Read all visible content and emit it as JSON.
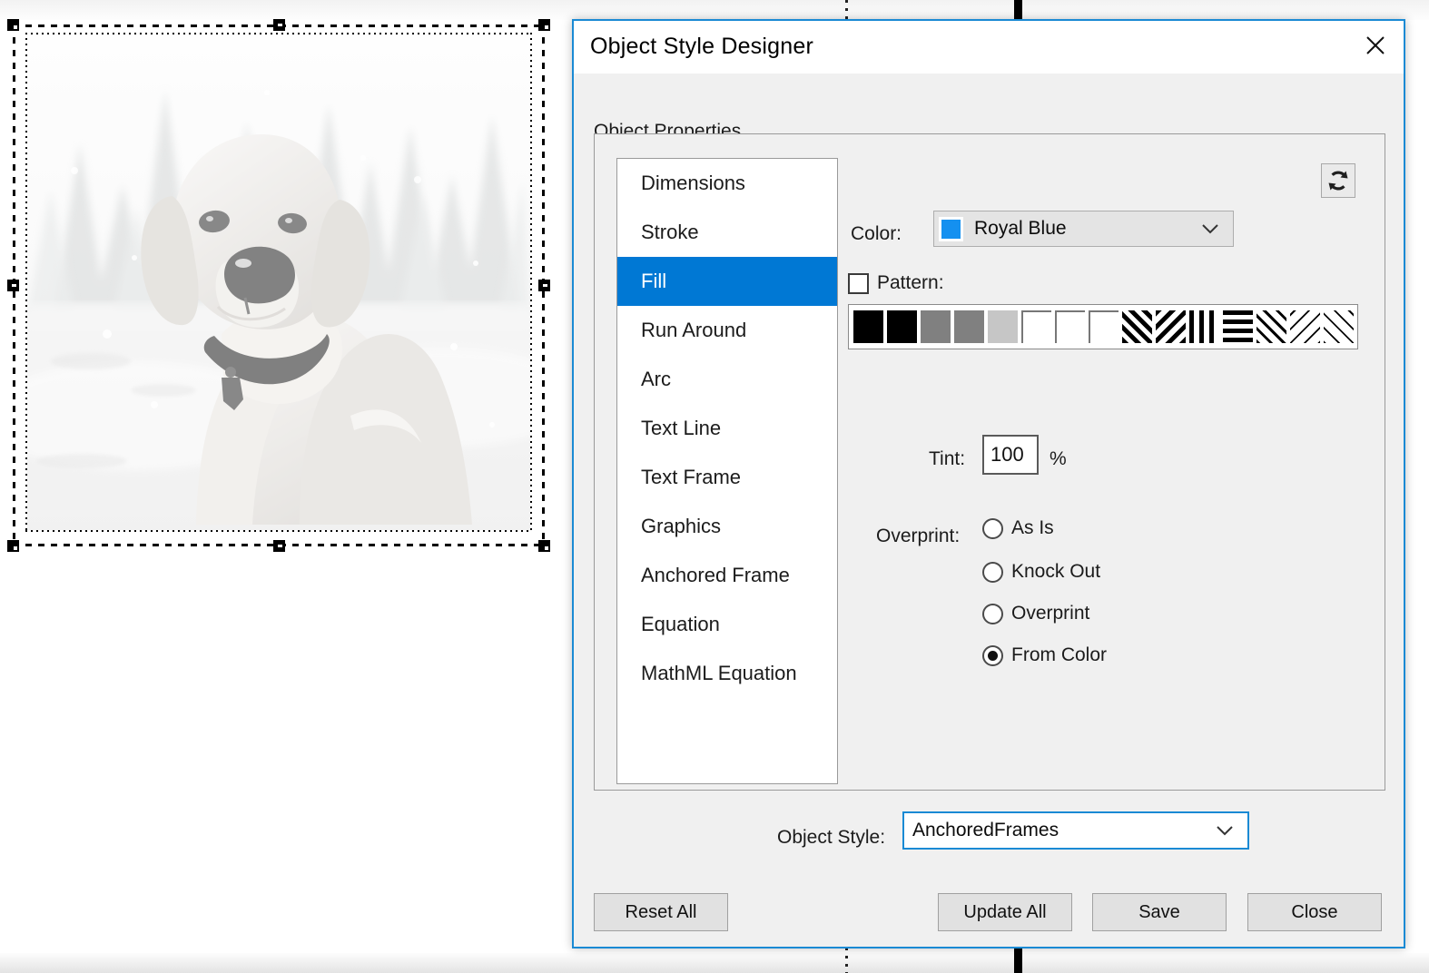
{
  "dialog": {
    "title": "Object Style Designer",
    "close_icon": "close-icon",
    "group_label": "Object Properties",
    "refresh_icon": "refresh-icon",
    "properties_list": [
      {
        "label": "Dimensions",
        "selected": false
      },
      {
        "label": "Stroke",
        "selected": false
      },
      {
        "label": "Fill",
        "selected": true
      },
      {
        "label": "Run Around",
        "selected": false
      },
      {
        "label": "Arc",
        "selected": false
      },
      {
        "label": "Text Line",
        "selected": false
      },
      {
        "label": "Text Frame",
        "selected": false
      },
      {
        "label": "Graphics",
        "selected": false
      },
      {
        "label": "Anchored Frame",
        "selected": false
      },
      {
        "label": "Equation",
        "selected": false
      },
      {
        "label": "MathML Equation",
        "selected": false
      }
    ],
    "fill": {
      "color_label": "Color:",
      "color_value": "Royal Blue",
      "color_hex": "#1490f0",
      "caret_icon": "chevron-down-icon",
      "pattern_label": "Pattern:",
      "pattern_checked": false,
      "pattern_swatches": [
        "solid-black",
        "solid-black",
        "gray-60",
        "gray-60",
        "gray-25",
        "white",
        "white",
        "white",
        "diagonal-thick-forward",
        "diagonal-back",
        "vertical-lines",
        "horizontal-lines",
        "crosshatch-diamond",
        "diagonal-thin-forward",
        "chevron-up"
      ],
      "tint_label": "Tint:",
      "tint_value": "100",
      "tint_unit": "%",
      "overprint_label": "Overprint:",
      "overprint_options": [
        {
          "label": "As Is",
          "checked": false
        },
        {
          "label": "Knock Out",
          "checked": false
        },
        {
          "label": "Overprint",
          "checked": false
        },
        {
          "label": "From Color",
          "checked": true
        }
      ]
    },
    "object_style_label": "Object Style:",
    "object_style_value": "AnchoredFrames",
    "object_style_caret": "chevron-down-icon",
    "buttons": {
      "reset_all": "Reset All",
      "update_all": "Update All",
      "save": "Save",
      "close": "Close"
    },
    "selection_blue": "#0078d4",
    "border_blue": "#1a8ad4"
  },
  "canvas": {
    "graphic_alt": "grayscale photo of a labrador dog sitting in snow with conifer trees",
    "selection_handles": 8
  }
}
